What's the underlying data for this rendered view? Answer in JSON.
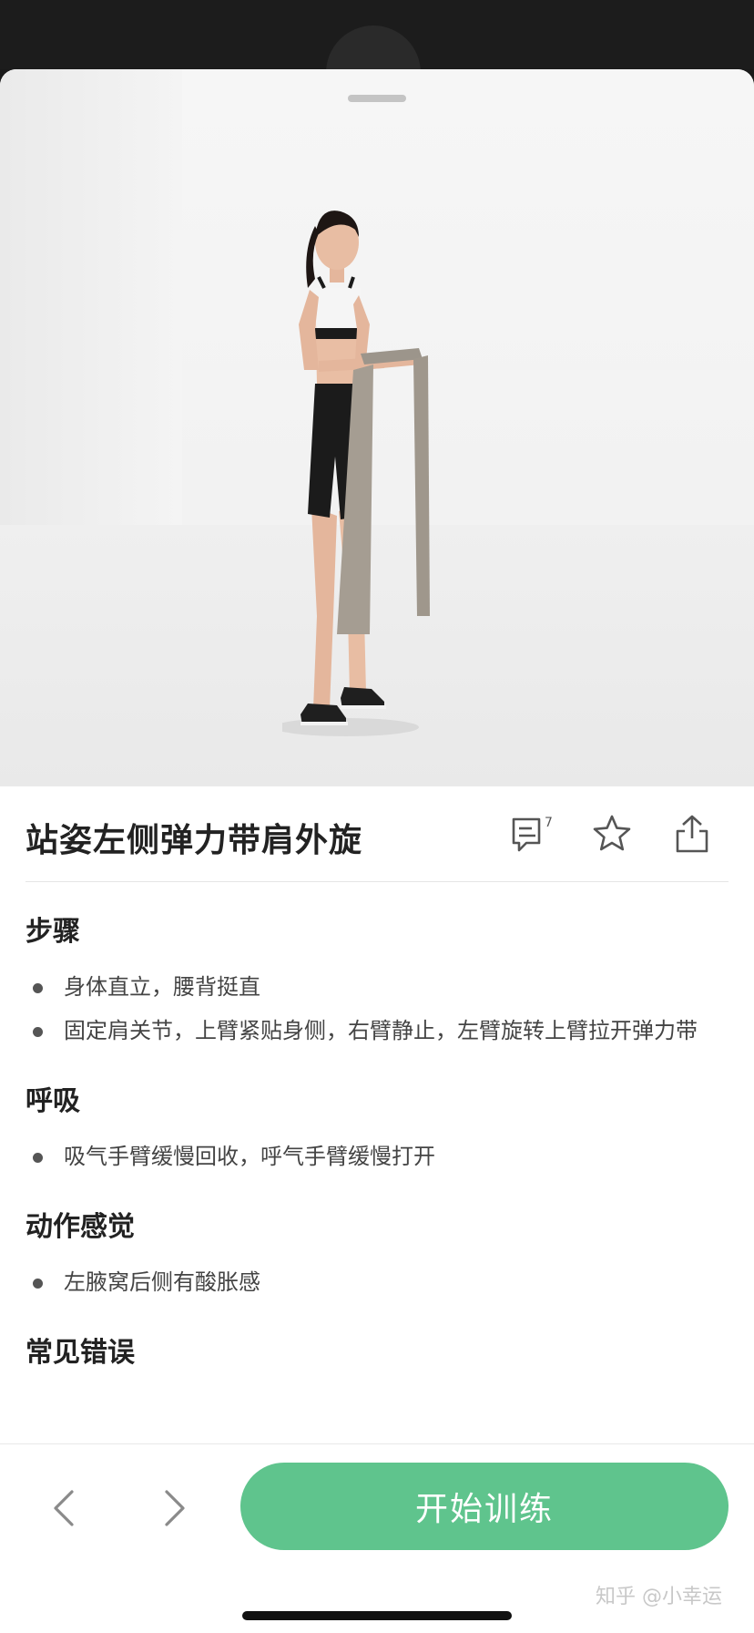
{
  "exercise": {
    "title": "站姿左侧弹力带肩外旋"
  },
  "actions": {
    "comment_count": "7"
  },
  "sections": [
    {
      "heading": "步骤",
      "items": [
        "身体直立，腰背挺直",
        "固定肩关节，上臂紧贴身侧，右臂静止，左臂旋转上臂拉开弹力带"
      ]
    },
    {
      "heading": "呼吸",
      "items": [
        "吸气手臂缓慢回收，呼气手臂缓慢打开"
      ]
    },
    {
      "heading": "动作感觉",
      "items": [
        "左腋窝后侧有酸胀感"
      ]
    },
    {
      "heading": "常见错误",
      "items": []
    }
  ],
  "bottom": {
    "start_label": "开始训练"
  },
  "watermark": "知乎 @小幸运",
  "colors": {
    "accent": "#5fc48d"
  }
}
